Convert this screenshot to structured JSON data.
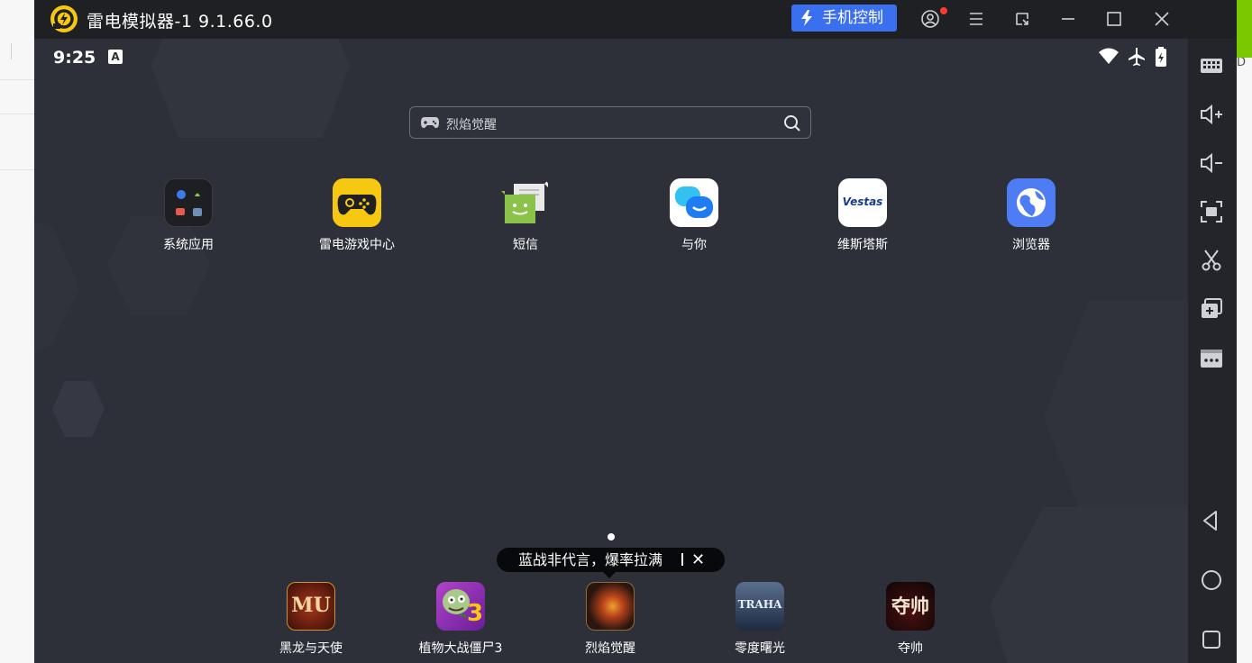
{
  "window": {
    "title": "雷电模拟器-1 9.1.66.0",
    "phone_control_label": "手机控制"
  },
  "background_app": {
    "partial_letter": "D"
  },
  "status_bar": {
    "time": "9:25",
    "badge": "A"
  },
  "search": {
    "placeholder": "烈焰觉醒"
  },
  "apps": [
    {
      "label": "系统应用",
      "icon": "system-apps-folder-icon"
    },
    {
      "label": "雷电游戏中心",
      "icon": "leidian-game-center-icon"
    },
    {
      "label": "短信",
      "icon": "sms-icon"
    },
    {
      "label": "与你",
      "icon": "yuni-chat-icon"
    },
    {
      "label": "维斯塔斯",
      "icon": "vestas-icon",
      "icon_text": "Vestas"
    },
    {
      "label": "浏览器",
      "icon": "browser-icon"
    }
  ],
  "tooltip": {
    "text": "蓝战非代言，爆率拉满"
  },
  "dock": [
    {
      "label": "黑龙与天使",
      "icon": "mu-game-icon",
      "icon_text": "MU"
    },
    {
      "label": "植物大战僵尸3",
      "icon": "pvz3-game-icon",
      "icon_text": "3"
    },
    {
      "label": "烈焰觉醒",
      "icon": "flame-awakening-game-icon"
    },
    {
      "label": "零度曙光",
      "icon": "traha-game-icon",
      "icon_text": "TRAHA"
    },
    {
      "label": "夺帅",
      "icon": "duoshuai-game-icon",
      "icon_text": "夺帅"
    }
  ],
  "colors": {
    "titlebar": "#1f2024",
    "screen": "#2d3039",
    "accent_blue": "#3a6ff0",
    "logo_yellow": "#f7c811",
    "nvidia_green": "#7bc800"
  }
}
